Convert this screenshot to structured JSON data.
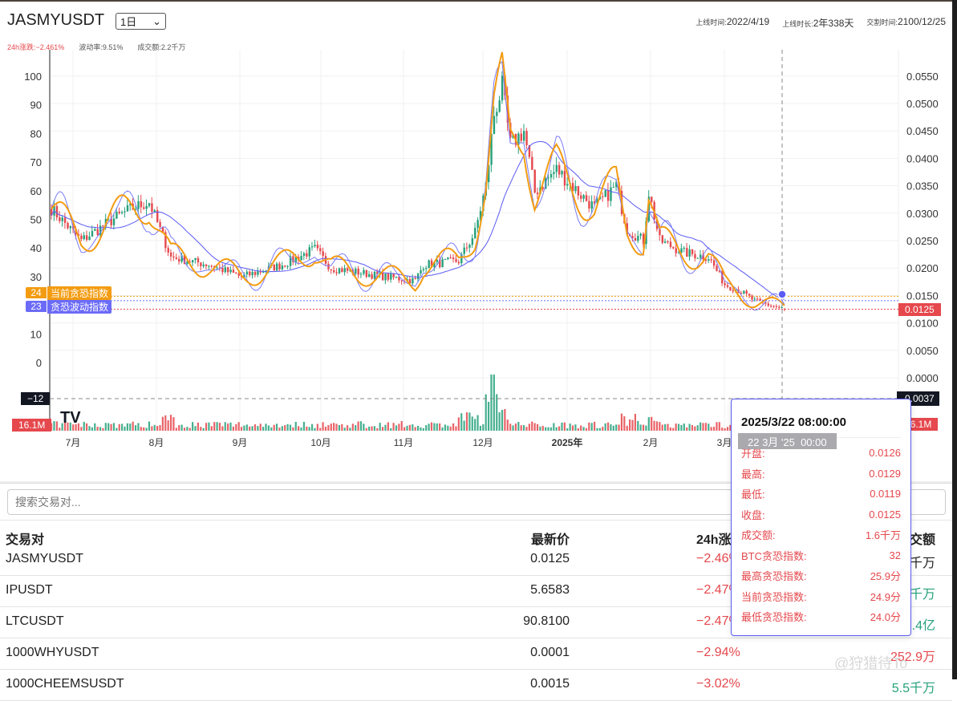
{
  "header": {
    "symbol": "JASMYUSDT",
    "interval": "1日",
    "listing_label": "上线时间:",
    "listing_value": "2022/4/19",
    "age_label": "上线时长:",
    "age_value": "2年338天",
    "delivery_label": "交割时间:",
    "delivery_value": "2100/12/25"
  },
  "stats": {
    "change_label": "24h涨跌:",
    "change_value": "−2.461%",
    "volatility_label": "波动率:",
    "volatility_value": "9.51%",
    "turnover_label": "成交额:",
    "turnover_value": "2.2千万"
  },
  "chart_data": {
    "type": "candlestick",
    "start_date": "2024-06-22",
    "end_date": "2025-03-22",
    "left_axis": {
      "ticks": [
        "100",
        "90",
        "80",
        "70",
        "60",
        "50",
        "40",
        "30",
        "10",
        "0"
      ],
      "range": [
        -20,
        105
      ]
    },
    "right_axis": {
      "ticks": [
        "0.0550",
        "0.0500",
        "0.0450",
        "0.0400",
        "0.0350",
        "0.0300",
        "0.0250",
        "0.0200",
        "0.0150",
        "0.0100",
        "0.0050",
        "0.0000"
      ],
      "range": [
        -0.0045,
        0.058
      ]
    },
    "x_ticks": [
      "7月",
      "8月",
      "9月",
      "10月",
      "11月",
      "12月",
      "2025年",
      "2月",
      "3月"
    ],
    "close_keyframes": [
      [
        0,
        0.0308
      ],
      [
        11,
        0.025
      ],
      [
        23,
        0.029
      ],
      [
        30,
        0.031
      ],
      [
        36,
        0.032
      ],
      [
        44,
        0.022
      ],
      [
        58,
        0.0206
      ],
      [
        70,
        0.0184
      ],
      [
        85,
        0.0206
      ],
      [
        97,
        0.0235
      ],
      [
        103,
        0.02
      ],
      [
        123,
        0.0184
      ],
      [
        134,
        0.0177
      ],
      [
        137,
        0.0206
      ],
      [
        150,
        0.0213
      ],
      [
        156,
        0.0265
      ],
      [
        160,
        0.035
      ],
      [
        163,
        0.048
      ],
      [
        166,
        0.053
      ],
      [
        169,
        0.0425
      ],
      [
        174,
        0.045
      ],
      [
        178,
        0.0338
      ],
      [
        186,
        0.038
      ],
      [
        194,
        0.0338
      ],
      [
        200,
        0.031
      ],
      [
        208,
        0.035
      ],
      [
        212,
        0.027
      ],
      [
        218,
        0.025
      ],
      [
        220,
        0.0338
      ],
      [
        224,
        0.025
      ],
      [
        233,
        0.0228
      ],
      [
        242,
        0.022
      ],
      [
        248,
        0.017
      ],
      [
        253,
        0.016
      ],
      [
        259,
        0.014
      ],
      [
        270,
        0.0125
      ]
    ],
    "series": [
      {
        "name": "当前贪恐指数",
        "value": 24,
        "color": "#f39c12"
      },
      {
        "name": "贪恐波动指数",
        "value": 23,
        "color": "#6b6bf7"
      }
    ],
    "last_price": "0.0125",
    "last_volume": "16.1M",
    "crosshair": {
      "left_value": "−12",
      "right_value": "-0.0037",
      "time": "22 3月 '25  00:00"
    }
  },
  "tooltip": {
    "time": "2025/3/22 08:00:00",
    "rows": [
      {
        "label": "开盘:",
        "value": "0.0126"
      },
      {
        "label": "最高:",
        "value": "0.0129"
      },
      {
        "label": "最低:",
        "value": "0.0119"
      },
      {
        "label": "收盘:",
        "value": "0.0125"
      },
      {
        "label": "成交额:",
        "value": "1.6千万"
      },
      {
        "label": "BTC贪恐指数:",
        "value": "32"
      },
      {
        "label": "最高贪恐指数:",
        "value": "25.9分"
      },
      {
        "label": "当前贪恐指数:",
        "value": "24.9分"
      },
      {
        "label": "最低贪恐指数:",
        "value": "24.0分"
      }
    ]
  },
  "search": {
    "placeholder": "搜索交易对..."
  },
  "table": {
    "headers": [
      "交易对",
      "最新价",
      "24h涨跌",
      "24h成交额"
    ],
    "rows": [
      {
        "pair": "JASMYUSDT",
        "price": "0.0125",
        "change": "−2.46%",
        "volume": "2.2千万",
        "vol_dir": "neutral"
      },
      {
        "pair": "IPUSDT",
        "price": "5.6583",
        "change": "−2.47%",
        "volume": "5.9千万",
        "vol_dir": "pos"
      },
      {
        "pair": "LTCUSDT",
        "price": "90.8100",
        "change": "−2.47%",
        "volume": "1.4亿",
        "vol_dir": "pos"
      },
      {
        "pair": "1000WHYUSDT",
        "price": "0.0001",
        "change": "−2.94%",
        "volume": "252.9万",
        "vol_dir": "neg"
      },
      {
        "pair": "1000CHEEMSUSDT",
        "price": "0.0015",
        "change": "−3.02%",
        "volume": "5.5千万",
        "vol_dir": "pos"
      }
    ]
  },
  "watermark": "@狩猎待To",
  "colors": {
    "up": "#26a17b",
    "down": "#e5484d",
    "orange": "#f39c12",
    "blue": "#6b6bf7"
  }
}
